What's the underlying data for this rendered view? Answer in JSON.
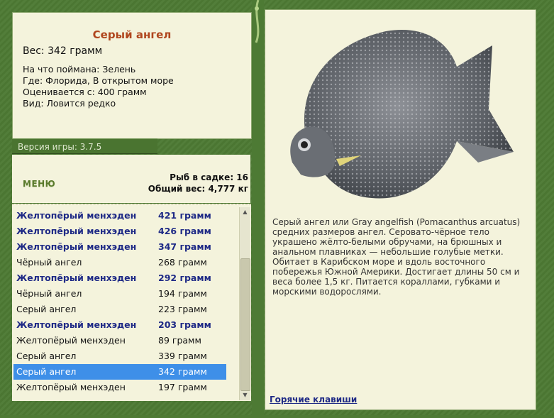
{
  "fish": {
    "title": "Серый ангел",
    "weight_line": "Вес: 342 грамм",
    "bait_line": "На что поймана: Зелень",
    "place_line": "Где: Флорида, В открытом море",
    "value_line": "Оценивается с: 400 грамм",
    "kind_line": "Вид: Ловится редко"
  },
  "version": {
    "text": "Версия игры: 3.7.5"
  },
  "menu": {
    "label": "МЕНЮ"
  },
  "stats": {
    "in_cage": "Рыб в садке: 16",
    "total_weight": "Общий вес: 4,777 кг"
  },
  "catch_list": [
    {
      "name": "Желтопёрый менхэден",
      "weight": "421 грамм",
      "bold": true
    },
    {
      "name": "Желтопёрый менхэден",
      "weight": "426 грамм",
      "bold": true
    },
    {
      "name": "Желтопёрый менхэден",
      "weight": "347 грамм",
      "bold": true
    },
    {
      "name": "Чёрный ангел",
      "weight": "268 грамм",
      "bold": false
    },
    {
      "name": "Желтопёрый менхэден",
      "weight": "292 грамм",
      "bold": true
    },
    {
      "name": "Чёрный ангел",
      "weight": "194 грамм",
      "bold": false
    },
    {
      "name": "Серый ангел",
      "weight": "223 грамм",
      "bold": false
    },
    {
      "name": "Желтопёрый менхэден",
      "weight": "203 грамм",
      "bold": true
    },
    {
      "name": "Желтопёрый менхэден",
      "weight": "89 грамм",
      "bold": false
    },
    {
      "name": "Серый ангел",
      "weight": "339 грамм",
      "bold": false
    },
    {
      "name": "Серый ангел",
      "weight": "342 грамм",
      "bold": false,
      "selected": true
    },
    {
      "name": "Желтопёрый менхэден",
      "weight": "197 грамм",
      "bold": false
    }
  ],
  "description": {
    "text": "Серый ангел или Gray angelfish (Pomacanthus arcuatus) средних размеров ангел. Серовато-чёрное тело украшено жёлто-белыми обручами, на брюшных и анальном плавниках — небольшие голубые метки. Обитает в Карибском море и вдоль восточного побережья Южной Америки. Достигает длины 50 см и веса более 1,5 кг. Питается кораллами, губками и морскими водорослями."
  },
  "hotkeys": {
    "label": "Горячие клавиши"
  },
  "colors": {
    "frame": "#4d7a34",
    "panel": "#f4f3dc",
    "title": "#b0461e",
    "bold_row": "#1f2a86",
    "selected_row": "#3e8fe8"
  },
  "icons": {
    "fish_image": "gray-angelfish-image",
    "vine": "vine-ornament-icon"
  }
}
